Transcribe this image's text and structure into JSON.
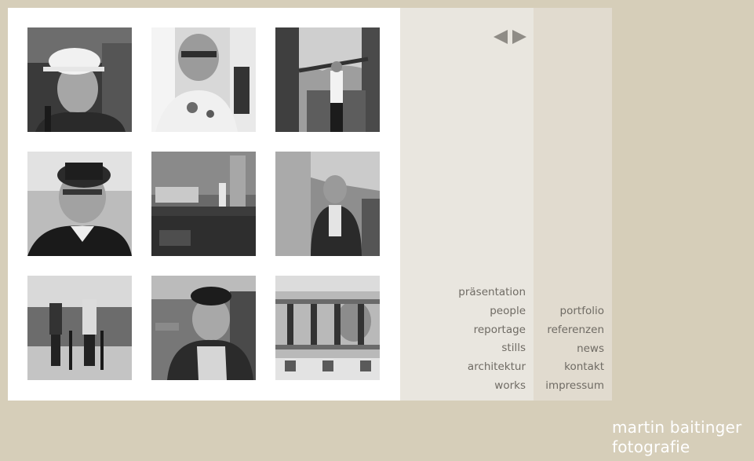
{
  "navigation": {
    "prev_label": "◀",
    "next_label": "▶"
  },
  "gallery": {
    "thumbnails": [
      {
        "subject": "worker in white hard hat"
      },
      {
        "subject": "man with glasses at machine"
      },
      {
        "subject": "man arms outstretched in quarry"
      },
      {
        "subject": "man in black hat"
      },
      {
        "subject": "stone workshop with worker"
      },
      {
        "subject": "man crouching by rock wall"
      },
      {
        "subject": "two workers with drills"
      },
      {
        "subject": "smiling worker in cap"
      },
      {
        "subject": "man behind machine parts"
      }
    ]
  },
  "menu_left": {
    "items": [
      "präsentation",
      "people",
      "reportage",
      "stills",
      "architektur",
      "works"
    ]
  },
  "menu_right": {
    "items": [
      "portfolio",
      "referenzen",
      "news",
      "kontakt",
      "impressum"
    ]
  },
  "brand": {
    "name": "martin baitinger",
    "tagline": "fotografie"
  },
  "colors": {
    "background": "#d6ceb9",
    "panel": "#ffffff",
    "column_mid": "#e9e6df",
    "column_right": "#e1dbcf",
    "menu_text": "#6f6b64",
    "arrow": "#8f8c86",
    "brand_text": "#ffffff"
  }
}
